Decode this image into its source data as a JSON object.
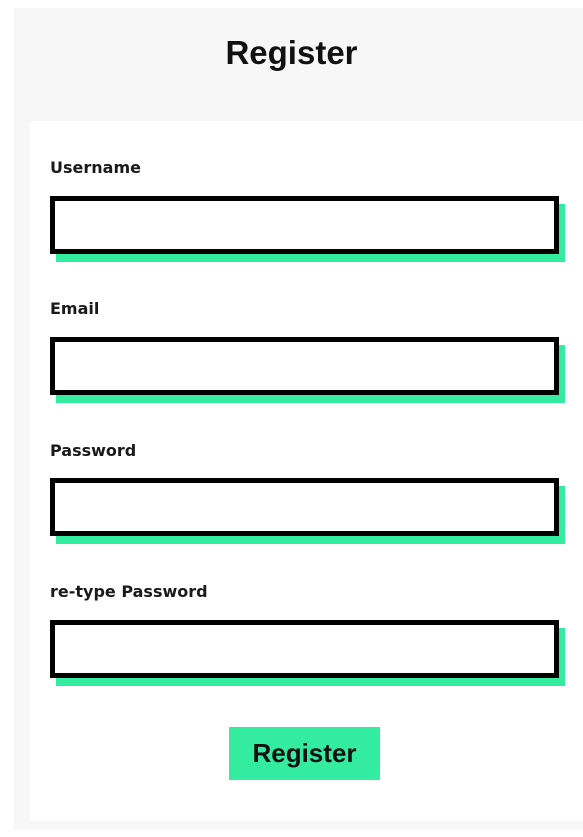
{
  "header": {
    "title": "Register"
  },
  "form": {
    "fields": [
      {
        "label": "Username",
        "value": "",
        "placeholder": ""
      },
      {
        "label": "Email",
        "value": "",
        "placeholder": ""
      },
      {
        "label": "Password",
        "value": "",
        "placeholder": ""
      },
      {
        "label": "re-type Password",
        "value": "",
        "placeholder": ""
      }
    ],
    "submit_label": "Register"
  },
  "colors": {
    "accent": "#33eca0",
    "border": "#000000",
    "page_bg": "#f7f7f7",
    "card_bg": "#ffffff"
  }
}
